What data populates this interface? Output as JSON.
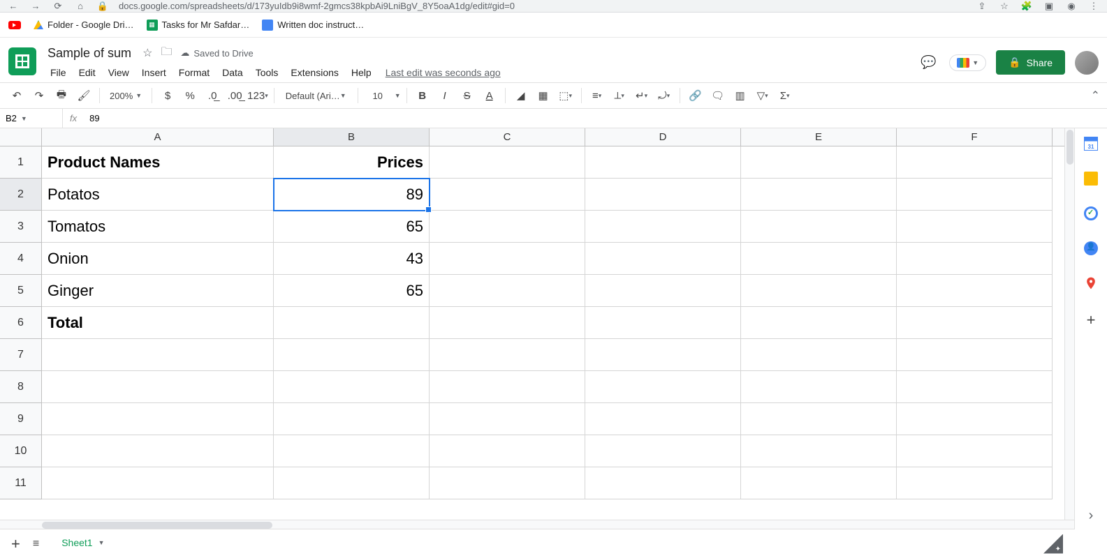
{
  "browser": {
    "url": "docs.google.com/spreadsheets/d/173yuIdb9i8wmf-2gmcs38kpbAi9LniBgV_8Y5oaA1dg/edit#gid=0",
    "bookmarks": [
      {
        "label": "Folder - Google Dri…",
        "icon": "drive"
      },
      {
        "label": "Tasks for Mr Safdar…",
        "icon": "sheets"
      },
      {
        "label": "Written doc instruct…",
        "icon": "docs"
      }
    ]
  },
  "header": {
    "doc_title": "Sample of sum",
    "save_status": "Saved to Drive",
    "menus": [
      "File",
      "Edit",
      "View",
      "Insert",
      "Format",
      "Data",
      "Tools",
      "Extensions",
      "Help"
    ],
    "last_edit": "Last edit was seconds ago",
    "share_label": "Share"
  },
  "toolbar": {
    "zoom": "200%",
    "font": "Default (Ari…",
    "font_size": "10",
    "number_format": "123"
  },
  "formula_bar": {
    "name_box": "B2",
    "value": "89"
  },
  "grid": {
    "columns": [
      "A",
      "B",
      "C",
      "D",
      "E",
      "F"
    ],
    "selected_cell": "B2",
    "rows": [
      {
        "n": "1",
        "A": "Product Names",
        "B": "Prices",
        "bold": true
      },
      {
        "n": "2",
        "A": "Potatos",
        "B": "89"
      },
      {
        "n": "3",
        "A": "Tomatos",
        "B": "65"
      },
      {
        "n": "4",
        "A": "Onion",
        "B": "43"
      },
      {
        "n": "5",
        "A": "Ginger",
        "B": "65"
      },
      {
        "n": "6",
        "A": "Total",
        "B": "",
        "bold": true
      },
      {
        "n": "7",
        "A": "",
        "B": ""
      },
      {
        "n": "8",
        "A": "",
        "B": ""
      },
      {
        "n": "9",
        "A": "",
        "B": ""
      },
      {
        "n": "10",
        "A": "",
        "B": ""
      },
      {
        "n": "11",
        "A": "",
        "B": ""
      }
    ]
  },
  "side_panel": {
    "calendar_day": "31"
  },
  "bottom": {
    "sheet_name": "Sheet1"
  }
}
